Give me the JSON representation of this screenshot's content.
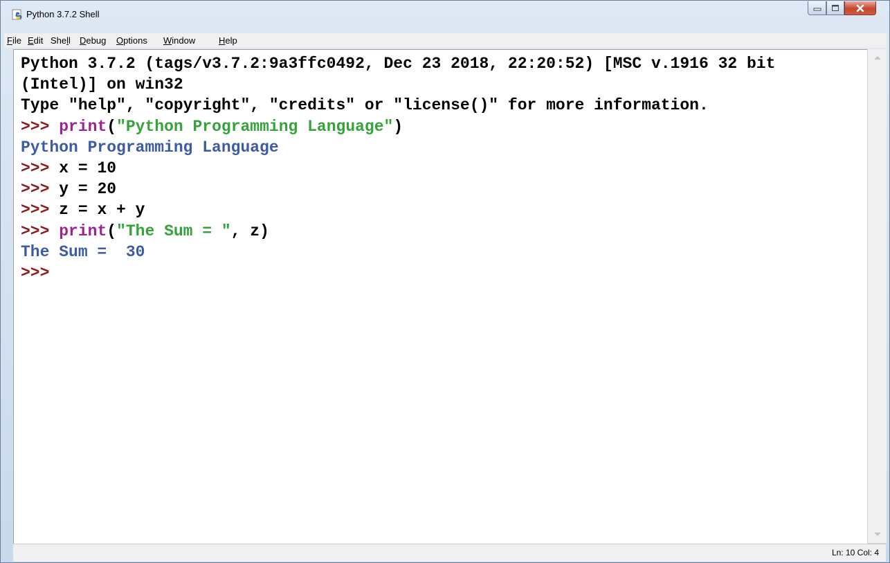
{
  "window": {
    "title": "Python 3.7.2 Shell"
  },
  "menu": {
    "file": {
      "pre": "",
      "u": "F",
      "post": "ile"
    },
    "edit": {
      "pre": "",
      "u": "E",
      "post": "dit"
    },
    "shell": {
      "pre": "She",
      "u": "l",
      "post": "l"
    },
    "debug": {
      "pre": "",
      "u": "D",
      "post": "ebug"
    },
    "options": {
      "pre": "",
      "u": "O",
      "post": "ptions"
    },
    "window": {
      "pre": "",
      "u": "W",
      "post": "indow"
    },
    "help": {
      "pre": "",
      "u": "H",
      "post": "elp"
    }
  },
  "shell": {
    "banner1": "Python 3.7.2 (tags/v3.7.2:9a3ffc0492, Dec 23 2018, 22:20:52) [MSC v.1916 32 bit",
    "banner2": "(Intel)] on win32",
    "banner3": "Type \"help\", \"copyright\", \"credits\" or \"license()\" for more information.",
    "prompt": ">>>",
    "l4_kw": "print",
    "l4_open": "(",
    "l4_str": "\"Python Programming Language\"",
    "l4_close": ")",
    "l5_out": "Python Programming Language",
    "l6_code": "x = 10",
    "l7_code": "y = 20",
    "l8_code": "z = x + y",
    "l9_kw": "print",
    "l9_open": "(",
    "l9_str": "\"The Sum = \"",
    "l9_rest": ", z)",
    "l10_out": "The Sum =  30"
  },
  "status": {
    "position": "Ln: 10  Col: 4"
  },
  "colors": {
    "prompt": "#8b1a1a",
    "keyword": "#9b2393",
    "string": "#33a33a",
    "output": "#3c5aa6"
  },
  "icons": {
    "app": "python-idle-icon",
    "minimize": "minimize-icon",
    "maximize": "maximize-icon",
    "close": "close-icon"
  }
}
